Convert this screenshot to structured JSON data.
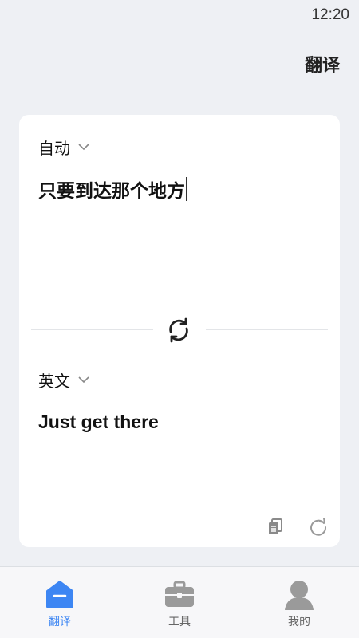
{
  "status_bar": {
    "time": "12:20"
  },
  "header": {
    "title": "翻译"
  },
  "translator": {
    "source_language": "自动",
    "source_text": "只要到达那个地方",
    "target_language": "英文",
    "target_text": "Just get there"
  },
  "bottom_nav": {
    "items": [
      {
        "label": "翻译",
        "icon": "home-icon",
        "active": true
      },
      {
        "label": "工具",
        "icon": "toolbox-icon",
        "active": false
      },
      {
        "label": "我的",
        "icon": "user-icon",
        "active": false
      }
    ]
  },
  "colors": {
    "accent": "#3d86f3",
    "background": "#eef0f4",
    "card": "#ffffff",
    "inactive_icon": "#9a9a9a"
  }
}
